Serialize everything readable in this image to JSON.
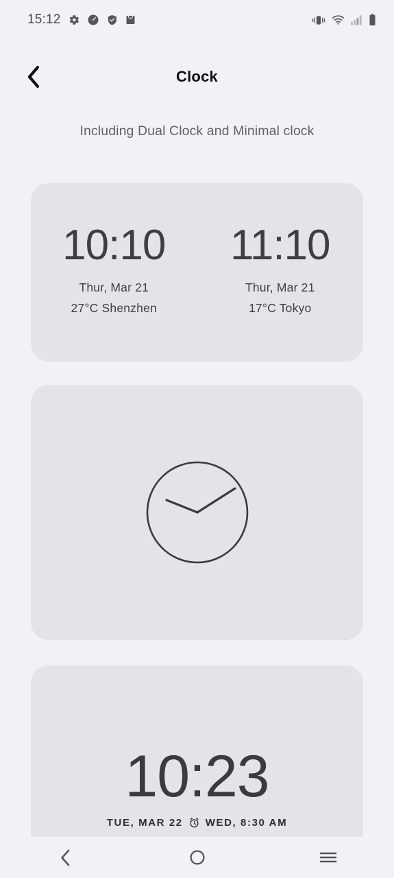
{
  "status_bar": {
    "time": "15:12",
    "left_icons": [
      "gear-icon",
      "speedometer-icon",
      "shield-check-icon",
      "shopping-bag-icon"
    ],
    "right_icons": [
      "vibrate-icon",
      "wifi-icon",
      "signal-bars-icon",
      "battery-icon"
    ],
    "colors": {
      "icon": "#55555c",
      "icon_dim": "#b9b9c0"
    }
  },
  "header": {
    "back_icon": "chevron-left-icon",
    "title": "Clock"
  },
  "subtitle": "Including Dual Clock and Minimal clock",
  "cards": {
    "dual_clock": {
      "name": "Dual Clock",
      "left": {
        "time": "10:10",
        "date": "Thur,  Mar 21",
        "weather": "27°C  Shenzhen"
      },
      "right": {
        "time": "11:10",
        "date": "Thur,  Mar 21",
        "weather": "17°C  Tokyo"
      }
    },
    "analog_clock": {
      "name": "Analog Clock",
      "icon": "analog-clock-face",
      "hour_hand_angle_deg": 290,
      "minute_hand_angle_deg": 57,
      "stroke_color": "#3a3a41"
    },
    "minimal_clock": {
      "name": "Minimal clock",
      "time": "10:23",
      "date": "TUE, MAR 22",
      "alarm_icon": "alarm-clock-icon",
      "alarm": "WED, 8:30 AM"
    }
  },
  "nav_bar": {
    "back": "chevron-left-icon",
    "home": "circle-icon",
    "recents": "hamburger-icon"
  },
  "theme": {
    "page_background": "#f2f1f5",
    "card_background": "#e5e3e9",
    "text_primary": "#111115",
    "text_secondary": "#61616a"
  }
}
